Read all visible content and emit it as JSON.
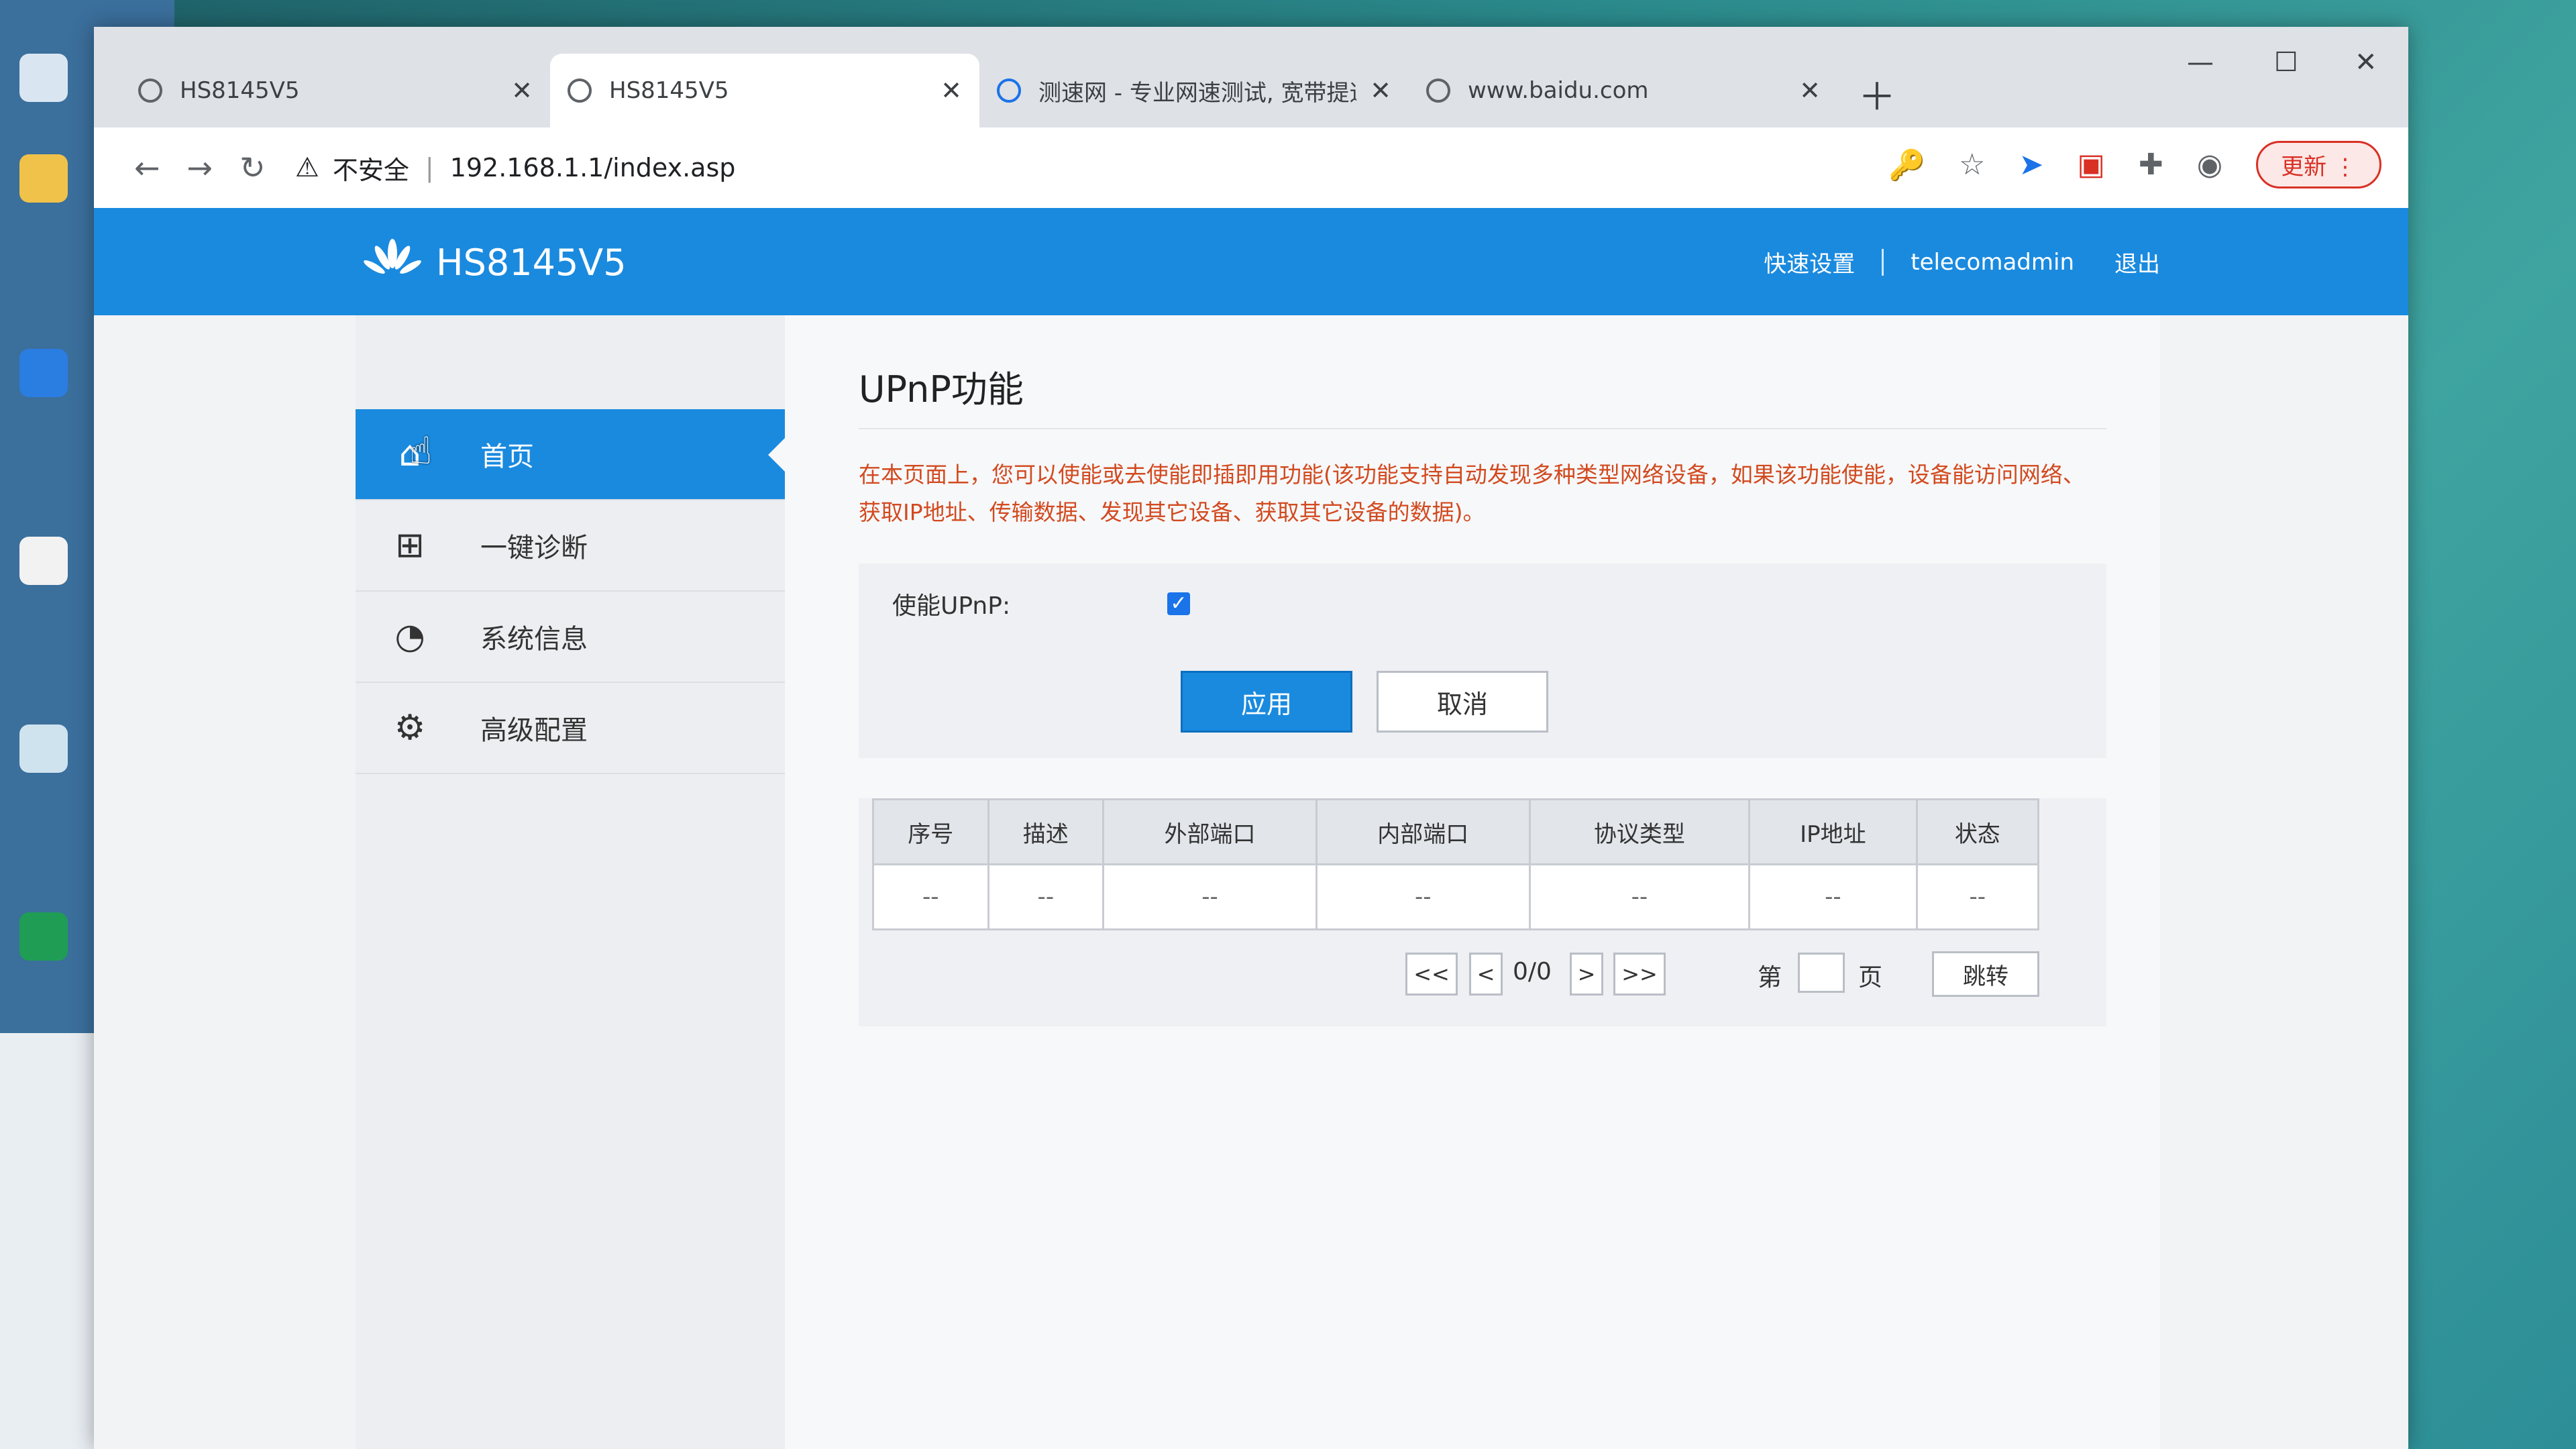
{
  "browser": {
    "tabs": [
      {
        "label": "HS8145V5"
      },
      {
        "label": "HS8145V5"
      },
      {
        "label": "测速网 - 专业网速测试, 宽带提速"
      },
      {
        "label": "www.baidu.com"
      }
    ],
    "address": {
      "insecure_label": "不安全",
      "url": "192.168.1.1/index.asp"
    },
    "update_label": "更新"
  },
  "header": {
    "brand": "HS8145V5",
    "quick_setup": "快速设置",
    "user": "telecomadmin",
    "logout": "退出"
  },
  "sidebar": {
    "items": [
      {
        "label": "首页"
      },
      {
        "label": "一键诊断"
      },
      {
        "label": "系统信息"
      },
      {
        "label": "高级配置"
      }
    ]
  },
  "main": {
    "title": "UPnP功能",
    "description": "在本页面上，您可以使能或去使能即插即用功能(该功能支持自动发现多种类型网络设备，如果该功能使能，设备能访问网络、获取IP地址、传输数据、发现其它设备、获取其它设备的数据)。",
    "enable_label": "使能UPnP:",
    "enable_checked": true,
    "apply_label": "应用",
    "cancel_label": "取消",
    "table": {
      "headers": [
        "序号",
        "描述",
        "外部端口",
        "内部端口",
        "协议类型",
        "IP地址",
        "状态"
      ],
      "row": [
        "--",
        "--",
        "--",
        "--",
        "--",
        "--",
        "--"
      ]
    },
    "pager": {
      "first": "<<",
      "prev": "<",
      "count": "0/0",
      "next": ">",
      "last": ">>",
      "page_prefix": "第",
      "page_suffix": "页",
      "jump": "跳转"
    }
  }
}
